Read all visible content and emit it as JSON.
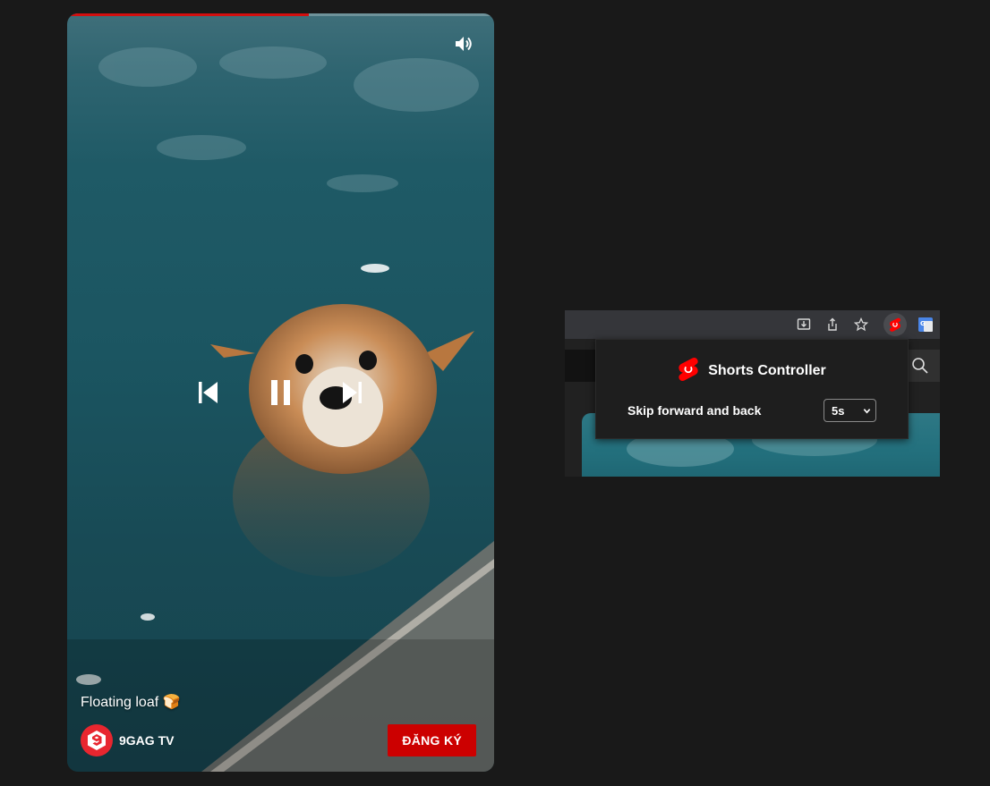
{
  "player": {
    "progress_fraction": 0.565,
    "caption": "Floating loaf 🍞",
    "channel_name": "9GAG TV",
    "subscribe_label": "ĐĂNG KÝ",
    "icons": {
      "mute": "volume-icon",
      "prev": "previous-icon",
      "pause": "pause-icon",
      "next": "next-icon",
      "avatar": "9gag-logo-icon"
    }
  },
  "browser": {
    "toolbar_icons": [
      "install-icon",
      "share-icon",
      "bookmark-star-icon",
      "shorts-extension-icon",
      "google-translate-icon"
    ]
  },
  "popup": {
    "title": "Shorts Controller",
    "skip_label": "Skip forward and back",
    "skip_value": "5s"
  },
  "colors": {
    "accent_red": "#cc0000",
    "progress_red": "#d20f0f",
    "background": "#191919"
  }
}
